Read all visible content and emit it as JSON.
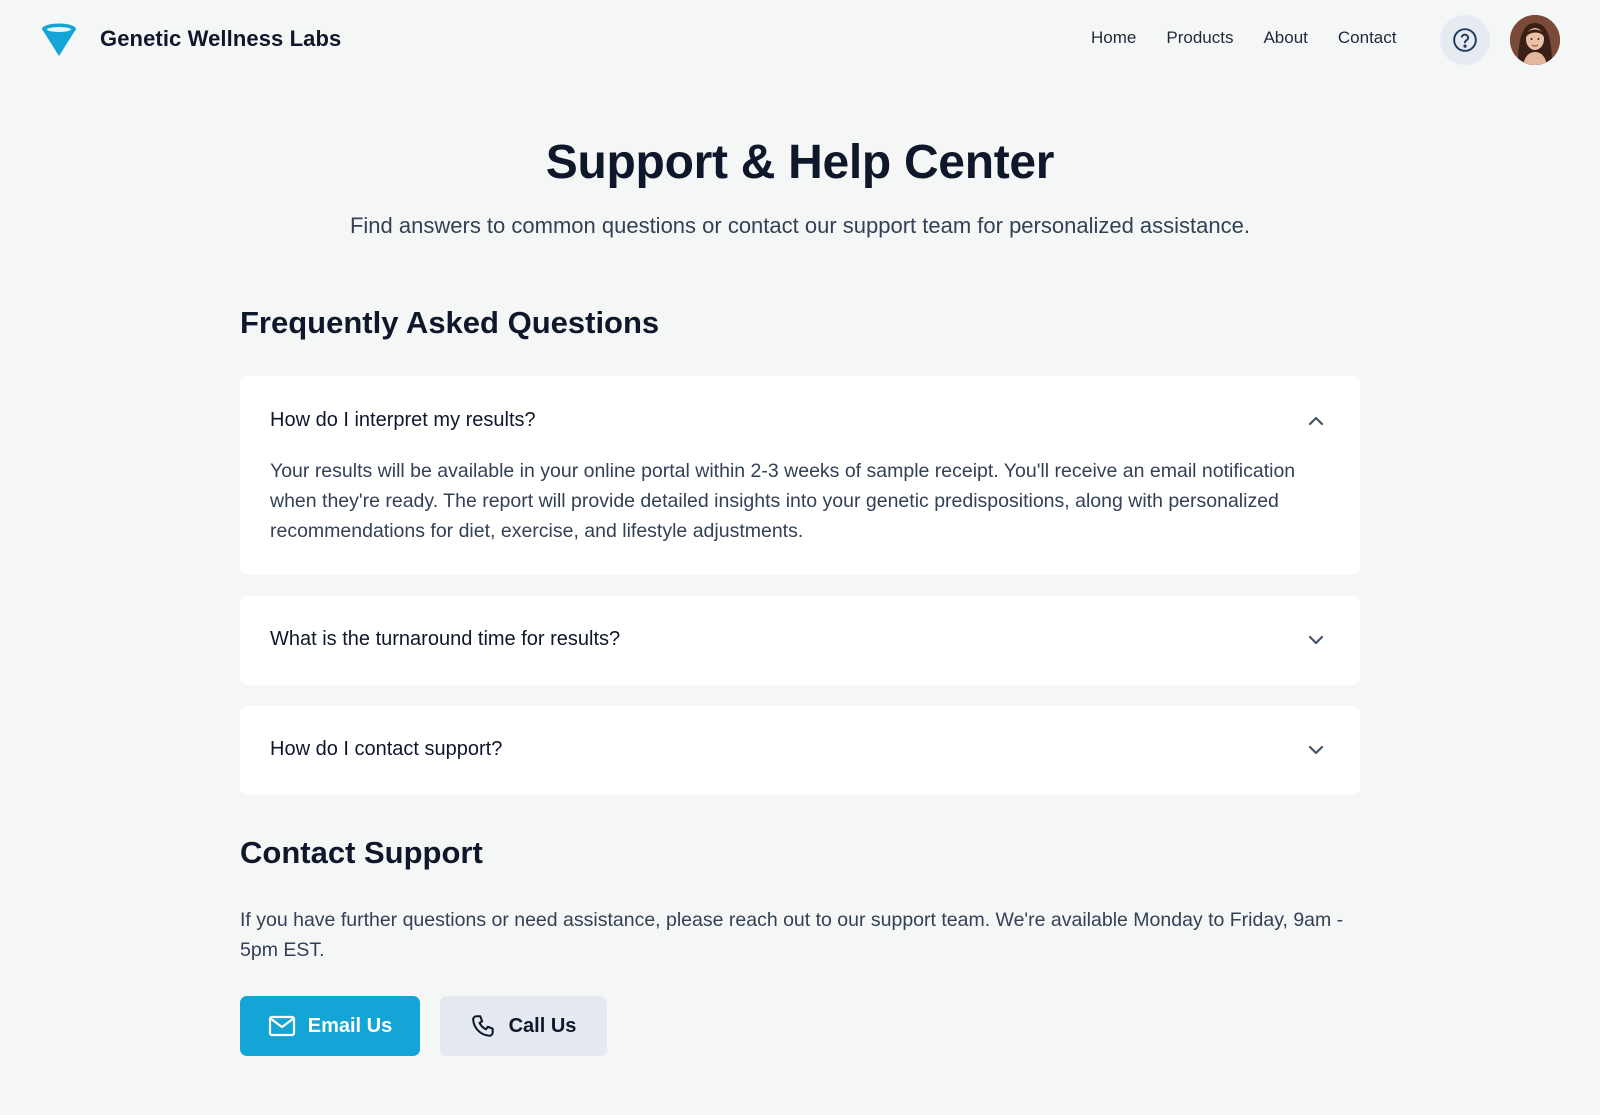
{
  "header": {
    "brand": "Genetic Wellness Labs",
    "logo_icon": "funnel-logo-icon",
    "nav": [
      "Home",
      "Products",
      "About",
      "Contact"
    ],
    "help_icon": "question-circle-icon",
    "avatar_icon": "user-avatar"
  },
  "hero": {
    "title": "Support & Help Center",
    "subtitle": "Find answers to common questions or contact our support team for personalized assistance."
  },
  "faq": {
    "title": "Frequently Asked Questions",
    "items": [
      {
        "question": "How do I interpret my results?",
        "expanded": true,
        "answer": "Your results will be available in your online portal within 2-3 weeks of sample receipt. You'll receive an email notification when they're ready. The report will provide detailed insights into your genetic predispositions, along with personalized recommendations for diet, exercise, and lifestyle adjustments."
      },
      {
        "question": "What is the turnaround time for results?",
        "expanded": false
      },
      {
        "question": "How do I contact support?",
        "expanded": false
      }
    ]
  },
  "contact": {
    "title": "Contact Support",
    "text": "If you have further questions or need assistance, please reach out to our support team. We're available Monday to Friday, 9am - 5pm EST.",
    "email_label": "Email Us",
    "call_label": "Call Us"
  },
  "colors": {
    "accent": "#13a5d6",
    "background": "#f5f7f7",
    "card": "#ffffff",
    "secondary_button": "#e5e9f0"
  }
}
